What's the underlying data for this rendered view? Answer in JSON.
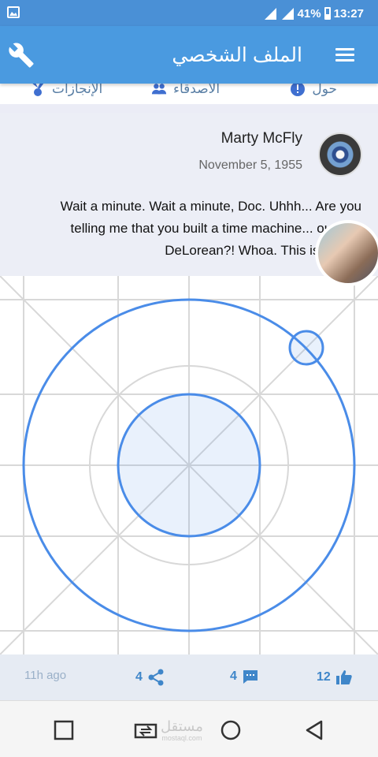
{
  "status_bar": {
    "battery": "41%",
    "time": "13:27"
  },
  "app_bar": {
    "title": "الملف الشخصي"
  },
  "tabs": [
    {
      "label": "حول",
      "icon": "info-icon"
    },
    {
      "label": "الأصدقاء",
      "icon": "friends-icon"
    },
    {
      "label": "الإنجازات",
      "icon": "achievements-icon"
    }
  ],
  "post": {
    "author": "Marty McFly",
    "date": "November 5, 1955",
    "text": "Wait a minute. Wait a minute, Doc. Uhhh... Are you telling me that you built a time machine... out of a DeLorean?! Whoa. This is heavy.",
    "time_ago": "11h ago",
    "shares": "4",
    "comments": "4",
    "likes": "12"
  },
  "watermark": {
    "arabic": "مستقل",
    "latin": "mostaql.com"
  },
  "colors": {
    "primary": "#4a9ae0",
    "accent": "#3f86c9",
    "status_bar": "#4a90d6"
  }
}
